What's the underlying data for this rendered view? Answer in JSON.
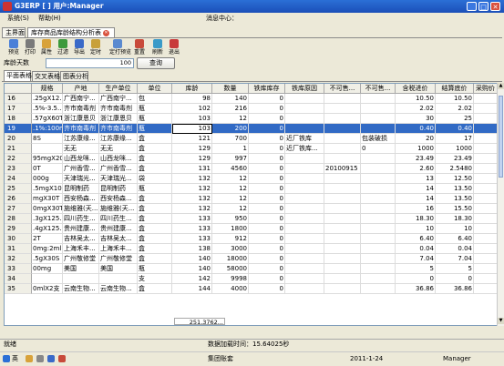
{
  "window": {
    "title": "G3ERP [ ] 用户:Manager"
  },
  "menu": {
    "items": [
      "系统(S)",
      "帮助(H)"
    ],
    "message_center": "消息中心："
  },
  "doc_tabs": [
    {
      "label": "主界面"
    },
    {
      "label": "库存商品库龄结构分析表"
    }
  ],
  "toolbar": {
    "buttons": [
      {
        "label": "预览",
        "icon": "preview-icon",
        "color": "#4a7fd8"
      },
      {
        "label": "打印",
        "icon": "print-icon",
        "color": "#7a7a7a"
      },
      {
        "label": "属性",
        "icon": "properties-icon",
        "color": "#d8a23a"
      },
      {
        "label": "过滤",
        "icon": "filter-icon",
        "color": "#3c9a3c"
      },
      {
        "label": "导出",
        "icon": "export-icon",
        "color": "#3a6ac8"
      },
      {
        "label": "定时",
        "icon": "timer-icon",
        "color": "#c8a03a"
      },
      {
        "label": "定打预览",
        "icon": "scheduled-preview-icon",
        "color": "#5a8ad0"
      },
      {
        "label": "重置",
        "icon": "reset-icon",
        "color": "#c84a3a"
      },
      {
        "label": "刷新",
        "icon": "refresh-icon",
        "color": "#3a9ac8"
      },
      {
        "label": "退出",
        "icon": "exit-icon",
        "color": "#c83a3a"
      }
    ]
  },
  "filter": {
    "age_label": "库龄天数",
    "age_value": "100",
    "query_button": "查询"
  },
  "sub_tabs": [
    {
      "label": "平面表格"
    },
    {
      "label": "交叉表格"
    },
    {
      "label": "图表分析"
    }
  ],
  "table": {
    "columns": [
      "",
      "规格",
      "产地",
      "生产单位",
      "单位",
      "库龄",
      "数量",
      "铁库库存",
      "铁库原因",
      "不可售...",
      "不可售...",
      "含税进价",
      "结算底价",
      "采购价"
    ],
    "rows": [
      [
        "16",
        ".25gX12...",
        "广西南宁...",
        "广西南宁...",
        "包",
        "98",
        "140",
        "0",
        "",
        "",
        "",
        "10.50",
        "10.50",
        ""
      ],
      [
        "17",
        ".5%-3.5...",
        "齐市南毒剂",
        "齐市南毒剂",
        "瓶",
        "102",
        "216",
        "0",
        "",
        "",
        "",
        "2.02",
        "2.02",
        ""
      ],
      [
        "18",
        ".57gX60T",
        "浙江康恩贝",
        "浙江康恩贝",
        "瓶",
        "103",
        "12",
        "0",
        "",
        "",
        "",
        "30",
        "25",
        ""
      ],
      [
        "19",
        ".1%:100ml",
        "齐市南毒剂",
        "齐市南毒剂",
        "瓶",
        "103",
        "200",
        "0",
        "",
        "",
        "",
        "0.40",
        "0.40",
        ""
      ],
      [
        "20",
        "8S",
        "江苏康缘...",
        "江苏康缘...",
        "盒",
        "121",
        "700",
        "0",
        "近厂铁库",
        "",
        "包装破损",
        "20",
        "17",
        ""
      ],
      [
        "21",
        "",
        "无无",
        "无无",
        "盒",
        "129",
        "1",
        "0",
        "近厂铁库...",
        "",
        "0",
        "1000",
        "1000",
        ""
      ],
      [
        "22",
        "95mgX20T",
        "山西龙咪...",
        "山西龙咪...",
        "盒",
        "129",
        "997",
        "0",
        "",
        "",
        "",
        "23.49",
        "23.49",
        ""
      ],
      [
        "23",
        "0T",
        "广州香雪...",
        "广州香雪...",
        "盒",
        "131",
        "4560",
        "0",
        "",
        "20100915",
        "",
        "2.60",
        "2.5480",
        ""
      ],
      [
        "24",
        "000g",
        "天津瑞光...",
        "天津瑞光...",
        "袋",
        "132",
        "12",
        "0",
        "",
        "",
        "",
        "13",
        "12.50",
        ""
      ],
      [
        "25",
        ".5mgX10...",
        "昆明制药",
        "昆明制药",
        "瓶",
        "132",
        "12",
        "0",
        "",
        "",
        "",
        "14",
        "13.50",
        ""
      ],
      [
        "26",
        "mgX30T",
        "西安杨森...",
        "西安杨森...",
        "盒",
        "132",
        "12",
        "0",
        "",
        "",
        "",
        "14",
        "13.50",
        ""
      ],
      [
        "27",
        "0mgX30T",
        "施维雅(天...",
        "施维雅(天...",
        "盒",
        "132",
        "12",
        "0",
        "",
        "",
        "",
        "16",
        "15.50",
        ""
      ],
      [
        "28",
        ".3gX125...",
        "四川药生...",
        "四川药生...",
        "盒",
        "133",
        "950",
        "0",
        "",
        "",
        "",
        "18.30",
        "18.30",
        ""
      ],
      [
        "29",
        ".4gX125...",
        "贵州建康...",
        "贵州建康...",
        "盒",
        "133",
        "1800",
        "0",
        "",
        "",
        "",
        "10",
        "10",
        ""
      ],
      [
        "30",
        "2T",
        "吉林吴太...",
        "吉林吴太...",
        "盒",
        "133",
        "912",
        "0",
        "",
        "",
        "",
        "6.40",
        "6.40",
        ""
      ],
      [
        "31",
        "0mg:2ml...",
        "上海禾丰...",
        "上海禾丰...",
        "盒",
        "138",
        "3000",
        "0",
        "",
        "",
        "",
        "0.04",
        "0.04",
        ""
      ],
      [
        "32",
        ".5gX30S",
        "广州敬修堂",
        "广州敬修堂",
        "盒",
        "140",
        "18000",
        "0",
        "",
        "",
        "",
        "7.04",
        "7.04",
        ""
      ],
      [
        "33",
        "00mg",
        "美国",
        "美国",
        "瓶",
        "140",
        "58000",
        "0",
        "",
        "",
        "",
        "5",
        "5",
        ""
      ],
      [
        "34",
        "",
        "",
        "",
        "支",
        "142",
        "9998",
        "0",
        "",
        "",
        "",
        "0",
        "0",
        ""
      ],
      [
        "35",
        "0mlX2支",
        "云南生物...",
        "云南生物...",
        "盒",
        "144",
        "4000",
        "0",
        "",
        "",
        "",
        "36.86",
        "36.86",
        ""
      ]
    ],
    "selected_row": 3,
    "total": "251.3762..."
  },
  "statusbar": {
    "left": "就绪",
    "load_time": "数据加载时间：15.64025秒"
  },
  "taskbar": {
    "company": "集团账套",
    "date": "2011-1-24",
    "user": "Manager"
  }
}
